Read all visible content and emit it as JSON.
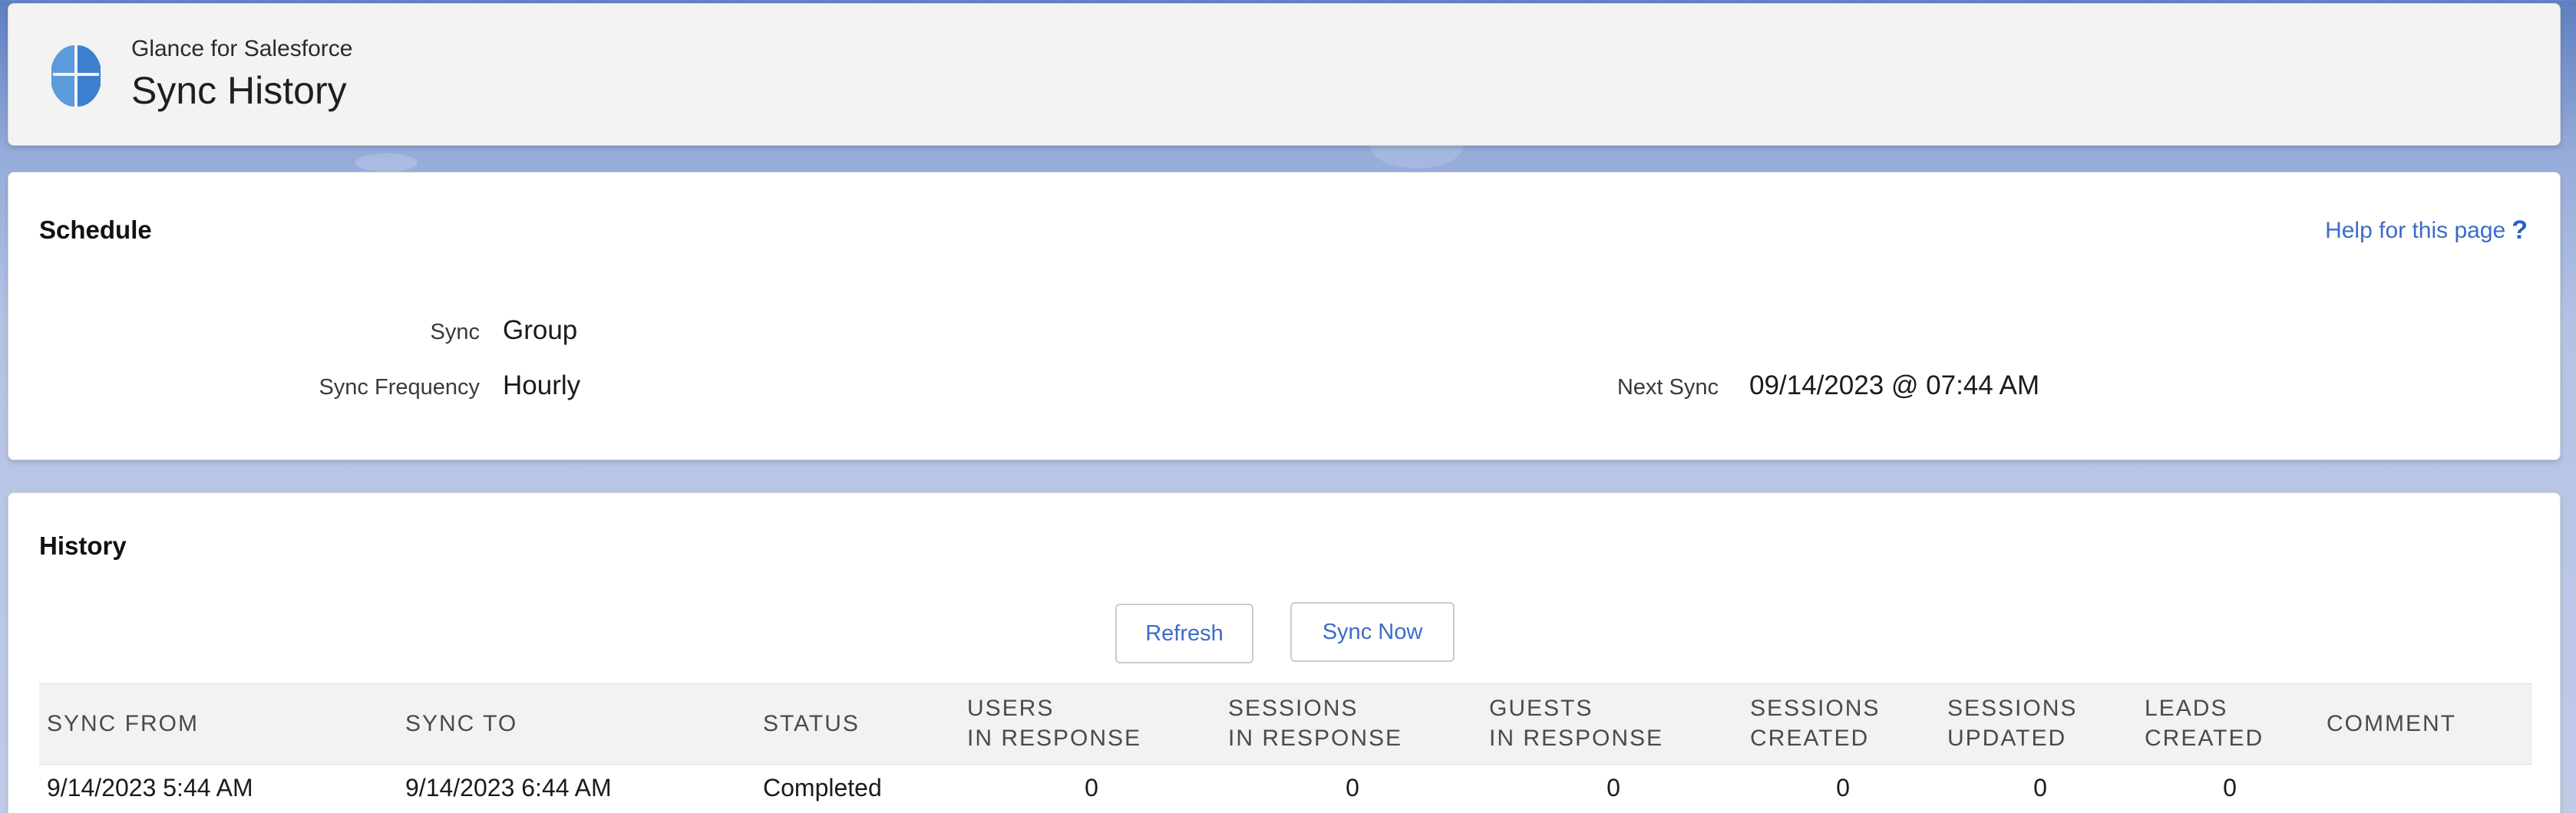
{
  "header": {
    "app_name": "Glance for Salesforce",
    "title": "Sync History",
    "icon": "glance-logo-icon"
  },
  "schedule": {
    "title": "Schedule",
    "help_link": "Help for this page",
    "help_icon": "?",
    "fields": {
      "sync_label": "Sync",
      "sync_value": "Group",
      "frequency_label": "Sync Frequency",
      "frequency_value": "Hourly",
      "next_sync_label": "Next Sync",
      "next_sync_value": "09/14/2023 @ 07:44 AM"
    }
  },
  "history": {
    "title": "History",
    "refresh_label": "Refresh",
    "sync_now_label": "Sync Now",
    "columns": [
      "SYNC FROM",
      "SYNC TO",
      "STATUS",
      "USERS\nIN RESPONSE",
      "SESSIONS\nIN RESPONSE",
      "GUESTS\nIN RESPONSE",
      "SESSIONS\nCREATED",
      "SESSIONS\nUPDATED",
      "LEADS\nCREATED",
      "COMMENT"
    ],
    "rows": [
      {
        "sync_from": "9/14/2023 5:44 AM",
        "sync_to": "9/14/2023 6:44 AM",
        "status": "Completed",
        "users_in_response": "0",
        "sessions_in_response": "0",
        "guests_in_response": "0",
        "sessions_created": "0",
        "sessions_updated": "0",
        "leads_created": "0",
        "comment": ""
      }
    ]
  },
  "colors": {
    "link": "#3b6cc8",
    "header_bg": "#f3f3f3",
    "icon_blue": "#4a90d9"
  }
}
